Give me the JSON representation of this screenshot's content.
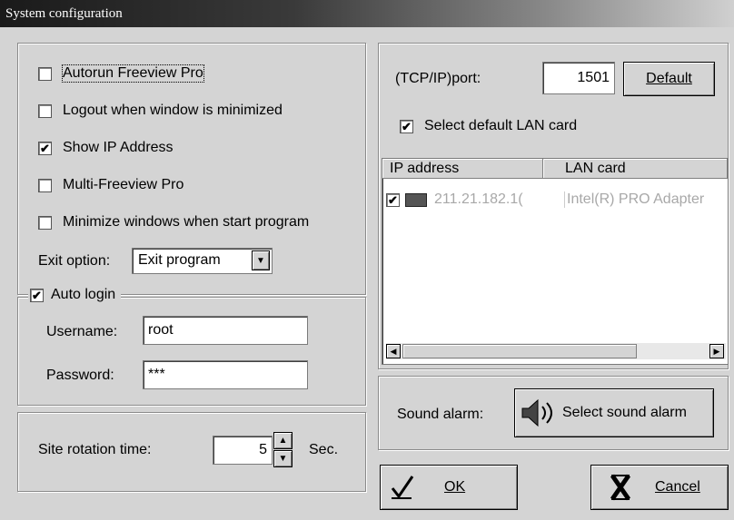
{
  "window": {
    "title": "System configuration"
  },
  "options": [
    {
      "label": "Autorun Freeview Pro",
      "checked": false
    },
    {
      "label": "Logout when window is minimized",
      "checked": false
    },
    {
      "label": "Show IP Address",
      "checked": true
    },
    {
      "label": "Multi-Freeview Pro",
      "checked": false
    },
    {
      "label": "Minimize windows when start program",
      "checked": false
    }
  ],
  "exit": {
    "label": "Exit option:",
    "value": "Exit program"
  },
  "autologin": {
    "label": "Auto login",
    "checked": true,
    "username_label": "Username:",
    "username": "root",
    "password_label": "Password:",
    "password": "***"
  },
  "rotation": {
    "label": "Site rotation time:",
    "value": "5",
    "unit": "Sec."
  },
  "network": {
    "port_label": "(TCP/IP)port:",
    "port": "1501",
    "default_label": "Default",
    "lan_label": "Select default LAN card",
    "lan_checked": true,
    "columns": [
      "IP address",
      "LAN card"
    ],
    "rows": [
      {
        "ip": "211.21.182.1(",
        "card": "Intel(R) PRO Adapter",
        "checked": true
      }
    ]
  },
  "sound": {
    "label": "Sound alarm:",
    "button": "Select sound alarm"
  },
  "actions": {
    "ok": "OK",
    "cancel": "Cancel"
  }
}
